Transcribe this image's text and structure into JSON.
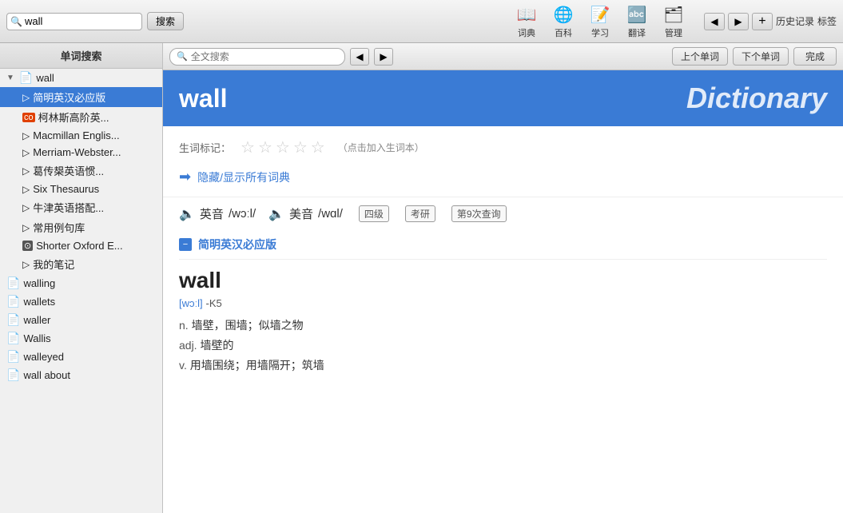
{
  "toolbar": {
    "search_value": "wall",
    "search_btn": "搜索",
    "icons": [
      {
        "name": "dict-icon",
        "label": "词典",
        "symbol": "📖"
      },
      {
        "name": "wiki-icon",
        "label": "百科",
        "symbol": "🌐"
      },
      {
        "name": "study-icon",
        "label": "学习",
        "symbol": "📝"
      },
      {
        "name": "translate-icon",
        "label": "翻译",
        "symbol": "🔤"
      },
      {
        "name": "manage-icon",
        "label": "管理",
        "symbol": "🗂"
      }
    ],
    "history_label": "历史记录",
    "bookmark_label": "标签",
    "prev_symbol": "◀",
    "next_symbol": "▶",
    "add_symbol": "+"
  },
  "sidebar": {
    "header": "单词搜索",
    "items": [
      {
        "id": "wall",
        "label": "wall",
        "type": "parent",
        "expanded": true,
        "selected": false
      },
      {
        "id": "jianjian",
        "label": "简明英汉必应版",
        "type": "subitem",
        "selected": true
      },
      {
        "id": "collins",
        "label": "柯林斯高阶英...",
        "type": "subitem",
        "has_icon": true
      },
      {
        "id": "macmillan",
        "label": "Macmillan Englis...",
        "type": "subitem"
      },
      {
        "id": "merriam",
        "label": "Merriam-Webster...",
        "type": "subitem"
      },
      {
        "id": "grape",
        "label": "葛传槼英语惯...",
        "type": "subitem"
      },
      {
        "id": "six",
        "label": "Six Thesaurus",
        "type": "subitem"
      },
      {
        "id": "oxford_collocations",
        "label": "牛津英语搭配...",
        "type": "subitem"
      },
      {
        "id": "examples",
        "label": "常用例句库",
        "type": "subitem"
      },
      {
        "id": "shorter_oxford",
        "label": "Shorter Oxford E...",
        "type": "subitem",
        "has_icon": true
      },
      {
        "id": "notes",
        "label": "我的笔记",
        "type": "subitem"
      },
      {
        "id": "walling",
        "label": "walling",
        "type": "word"
      },
      {
        "id": "wallets",
        "label": "wallets",
        "type": "word"
      },
      {
        "id": "waller",
        "label": "waller",
        "type": "word"
      },
      {
        "id": "wallis",
        "label": "Wallis",
        "type": "word"
      },
      {
        "id": "walleyed",
        "label": "walleyed",
        "type": "word"
      },
      {
        "id": "wallabout",
        "label": "wall about",
        "type": "word"
      }
    ]
  },
  "content": {
    "search_placeholder": "全文搜索",
    "prev_btn": "◀",
    "next_btn": "▶",
    "prev_word_btn": "上个单词",
    "next_word_btn": "下个单词",
    "done_btn": "完成"
  },
  "dictionary": {
    "word": "wall",
    "brand": "Dictionary",
    "stars_label": "生词标记：",
    "stars_hint": "（点击加入生词本）",
    "show_all_link": "隐藏/显示所有词典",
    "phonetics": {
      "uk_label": "英音",
      "uk_ipa": "/wɔːl/",
      "us_label": "美音",
      "us_ipa": "/wɑl/",
      "badges": [
        "四级",
        "考研",
        "第9次查询"
      ]
    },
    "section": {
      "title": "简明英汉必应版",
      "collapse": "−",
      "entry_word": "wall",
      "entry_phonetic_prefix": "[wɔːl]",
      "entry_phonetic_suffix": "-K5",
      "def1_pos": "n.",
      "def1_text": " 墙壁，围墙；似墙之物",
      "def2_pos": "adj.",
      "def2_text": " 墙壁的",
      "def3_pos": "v.",
      "def3_text": " 用墙围绕；用墙隔开；筑墙"
    }
  }
}
